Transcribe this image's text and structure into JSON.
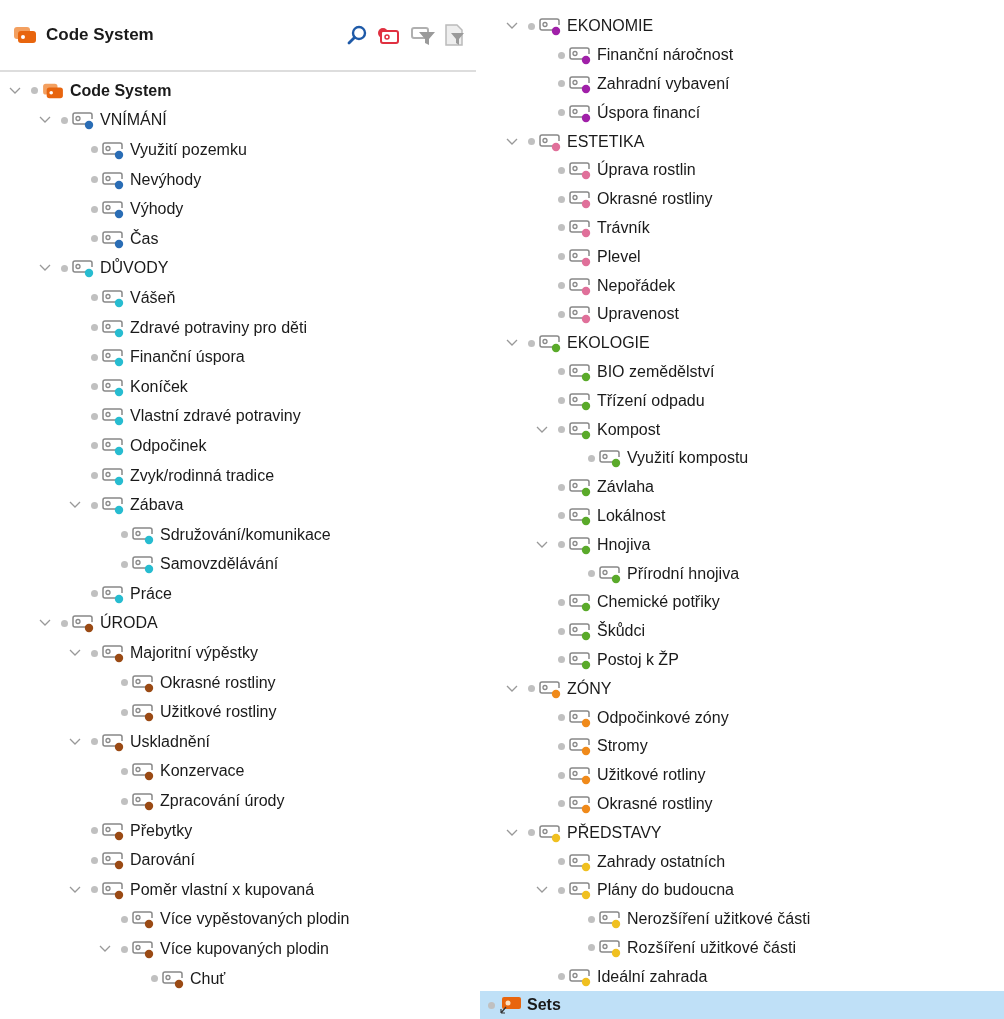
{
  "panel": {
    "title": "Code System"
  },
  "tree": {
    "label": "Code System",
    "selected": false,
    "expanded": true,
    "children": [
      {
        "label": "VNÍMÁNÍ",
        "color": "#2a6db5",
        "selected": false,
        "expanded": true,
        "children": [
          {
            "label": "Využití pozemku",
            "color": "#2a6db5",
            "selected": false
          },
          {
            "label": "Nevýhody",
            "color": "#2a6db5",
            "selected": false
          },
          {
            "label": "Výhody",
            "color": "#2a6db5",
            "selected": false
          },
          {
            "label": "Čas",
            "color": "#2a6db5",
            "selected": false
          }
        ]
      },
      {
        "label": "DŮVODY",
        "color": "#27bcd0",
        "selected": false,
        "expanded": true,
        "children": [
          {
            "label": "Vášeň",
            "color": "#27bcd0",
            "selected": false
          },
          {
            "label": "Zdravé potraviny pro děti",
            "color": "#27bcd0",
            "selected": false
          },
          {
            "label": "Finanční úspora",
            "color": "#27bcd0",
            "selected": false
          },
          {
            "label": "Koníček",
            "color": "#27bcd0",
            "selected": false
          },
          {
            "label": "Vlastní zdravé potraviny",
            "color": "#27bcd0",
            "selected": false
          },
          {
            "label": "Odpočinek",
            "color": "#27bcd0",
            "selected": false
          },
          {
            "label": "Zvyk/rodinná tradice",
            "color": "#27bcd0",
            "selected": false
          },
          {
            "label": "Zábava",
            "color": "#27bcd0",
            "selected": false,
            "expanded": true,
            "children": [
              {
                "label": "Sdružování/komunikace",
                "color": "#27bcd0",
                "selected": false
              },
              {
                "label": "Samovzdělávání",
                "color": "#27bcd0",
                "selected": false
              }
            ]
          },
          {
            "label": "Práce",
            "color": "#27bcd0",
            "selected": false
          }
        ]
      },
      {
        "label": "ÚRODA",
        "color": "#9a4a14",
        "selected": false,
        "expanded": true,
        "children": [
          {
            "label": "Majoritní výpěstky",
            "color": "#9a4a14",
            "selected": false,
            "expanded": true,
            "children": [
              {
                "label": "Okrasné rostliny",
                "color": "#9a4a14",
                "selected": false
              },
              {
                "label": "Užitkové rostliny",
                "color": "#9a4a14",
                "selected": false
              }
            ]
          },
          {
            "label": "Uskladnění",
            "color": "#9a4a14",
            "selected": false,
            "expanded": true,
            "children": [
              {
                "label": "Konzervace",
                "color": "#9a4a14",
                "selected": false
              },
              {
                "label": "Zpracování úrody",
                "color": "#9a4a14",
                "selected": false
              }
            ]
          },
          {
            "label": "Přebytky",
            "color": "#9a4a14",
            "selected": false
          },
          {
            "label": "Darování",
            "color": "#9a4a14",
            "selected": false
          },
          {
            "label": "Poměr vlastní x kupovaná",
            "color": "#9a4a14",
            "selected": false,
            "expanded": true,
            "children": [
              {
                "label": "Více vypěstovaných plodin",
                "color": "#9a4a14",
                "selected": false
              },
              {
                "label": "Více kupovaných plodin",
                "color": "#9a4a14",
                "selected": false,
                "expanded": true,
                "children": [
                  {
                    "label": "Chuť",
                    "color": "#9a4a14",
                    "selected": false
                  }
                ]
              }
            ]
          }
        ]
      },
      {
        "label": "EKONOMIE",
        "color": "#a020a8",
        "selected": false,
        "expanded": true,
        "children": [
          {
            "label": "Finanční náročnost",
            "color": "#a020a8",
            "selected": false
          },
          {
            "label": "Zahradní vybavení",
            "color": "#a020a8",
            "selected": false
          },
          {
            "label": "Úspora financí",
            "color": "#a020a8",
            "selected": false
          }
        ]
      },
      {
        "label": "ESTETIKA",
        "color": "#e0709a",
        "selected": false,
        "expanded": true,
        "children": [
          {
            "label": "Úprava rostlin",
            "color": "#e0709a",
            "selected": false
          },
          {
            "label": "Okrasné rostliny",
            "color": "#e0709a",
            "selected": false
          },
          {
            "label": "Trávník",
            "color": "#e0709a",
            "selected": false
          },
          {
            "label": "Plevel",
            "color": "#e0709a",
            "selected": false
          },
          {
            "label": "Nepořádek",
            "color": "#e0709a",
            "selected": false
          },
          {
            "label": "Upravenost",
            "color": "#e0709a",
            "selected": false
          }
        ]
      },
      {
        "label": "EKOLOGIE",
        "color": "#5aaa2a",
        "selected": false,
        "expanded": true,
        "children": [
          {
            "label": "BIO zemědělství",
            "color": "#5aaa2a",
            "selected": false
          },
          {
            "label": "Třízení odpadu",
            "color": "#5aaa2a",
            "selected": false
          },
          {
            "label": "Kompost",
            "color": "#5aaa2a",
            "selected": false,
            "expanded": true,
            "children": [
              {
                "label": "Využití kompostu",
                "color": "#5aaa2a",
                "selected": false
              }
            ]
          },
          {
            "label": "Závlaha",
            "color": "#5aaa2a",
            "selected": false
          },
          {
            "label": "Lokálnost",
            "color": "#5aaa2a",
            "selected": false
          },
          {
            "label": "Hnojiva",
            "color": "#5aaa2a",
            "selected": false,
            "expanded": true,
            "children": [
              {
                "label": "Přírodní hnojiva",
                "color": "#5aaa2a",
                "selected": false
              }
            ]
          },
          {
            "label": "Chemické potřiky",
            "color": "#5aaa2a",
            "selected": false
          },
          {
            "label": "Škůdci",
            "color": "#5aaa2a",
            "selected": false
          },
          {
            "label": "Postoj k ŽP",
            "color": "#5aaa2a",
            "selected": false
          }
        ]
      },
      {
        "label": "ZÓNY",
        "color": "#f08a1a",
        "selected": false,
        "expanded": true,
        "children": [
          {
            "label": "Odpočinkové zóny",
            "color": "#f08a1a",
            "selected": false
          },
          {
            "label": "Stromy",
            "color": "#f08a1a",
            "selected": false
          },
          {
            "label": "Užitkové rotliny",
            "color": "#f08a1a",
            "selected": false
          },
          {
            "label": "Okrasné rostliny",
            "color": "#f08a1a",
            "selected": false
          }
        ]
      },
      {
        "label": "PŘEDSTAVY",
        "color": "#f0c020",
        "selected": false,
        "expanded": true,
        "children": [
          {
            "label": "Zahrady ostatních",
            "color": "#f0c020",
            "selected": false
          },
          {
            "label": "Plány do budoucna",
            "color": "#f0c020",
            "selected": false,
            "expanded": true,
            "children": [
              {
                "label": "Nerozšíření užitkové části",
                "color": "#f0c020",
                "selected": false
              },
              {
                "label": "Rozšíření užitkové části",
                "color": "#f0c020",
                "selected": false
              }
            ]
          },
          {
            "label": "Ideální zahrada",
            "color": "#f0c020",
            "selected": false
          }
        ]
      }
    ]
  },
  "sets": {
    "label": "Sets",
    "selected": true
  }
}
